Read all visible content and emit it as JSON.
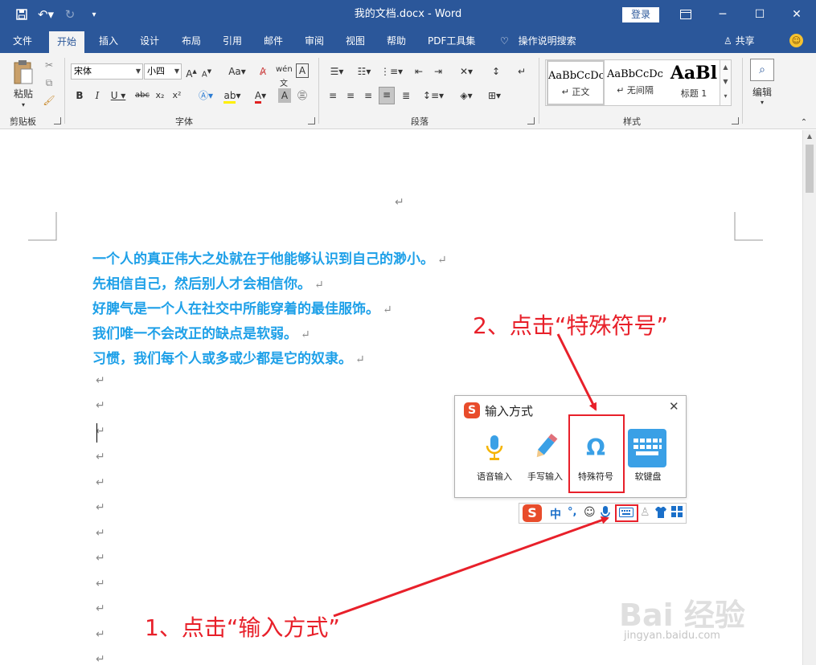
{
  "titlebar": {
    "doc_title": "我的文档.docx - Word",
    "login": "登录",
    "save_icon": "save-icon",
    "undo_icon": "undo-icon",
    "redo_icon": "redo-icon"
  },
  "tabs": [
    "文件",
    "开始",
    "插入",
    "设计",
    "布局",
    "引用",
    "邮件",
    "审阅",
    "视图",
    "帮助",
    "PDF工具集"
  ],
  "active_tab": "开始",
  "tell_me": "操作说明搜索",
  "share": "共享",
  "ribbon": {
    "clipboard": {
      "paste": "粘贴",
      "label": "剪贴板"
    },
    "font": {
      "name": "宋体",
      "size": "小四",
      "label": "字体"
    },
    "paragraph": {
      "label": "段落"
    },
    "styles": {
      "label": "样式",
      "items": [
        {
          "preview": "AaBbCcDc",
          "name": "↵ 正文"
        },
        {
          "preview": "AaBbCcDc",
          "name": "↵ 无间隔"
        },
        {
          "preview": "AaBl",
          "name": "标题 1"
        }
      ]
    },
    "edit": {
      "label": "编辑"
    }
  },
  "document": {
    "lines": [
      "一个人的真正伟大之处就在于他能够认识到自己的渺小。",
      "先相信自己，然后别人才会相信你。",
      "好脾气是一个人在社交中所能穿着的最佳服饰。",
      "我们唯一不会改正的缺点是软弱。",
      "习惯，我们每个人或多或少都是它的奴隶。"
    ],
    "para_mark": "↵",
    "text_color": "#1ea0e8"
  },
  "ime_panel": {
    "title": "输入方式",
    "items": [
      {
        "label": "语音输入",
        "icon": "microphone-icon"
      },
      {
        "label": "手写输入",
        "icon": "pencil-icon"
      },
      {
        "label": "特殊符号",
        "icon": "omega-icon"
      },
      {
        "label": "软键盘",
        "icon": "keyboard-icon"
      }
    ]
  },
  "ime_bar": {
    "lang": "中",
    "punct": "°,"
  },
  "annotations": {
    "step1": "1、点击“输入方式”",
    "step2": "2、点击“特殊符号”",
    "color": "#e8202a"
  },
  "watermark": {
    "text": "Bai 经验",
    "url": "jingyan.baidu.com"
  }
}
